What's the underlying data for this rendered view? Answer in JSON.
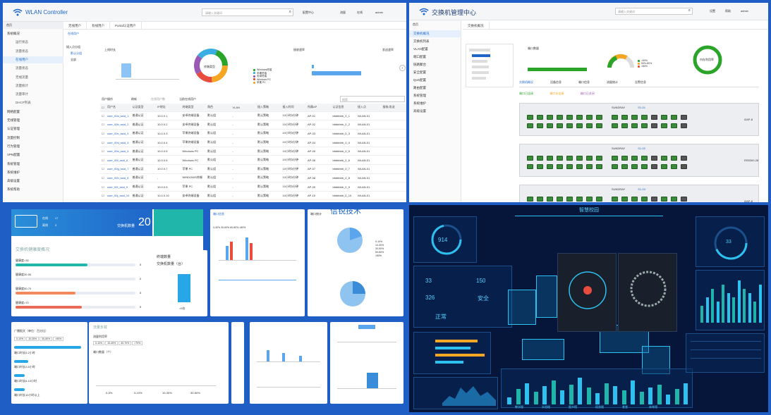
{
  "q1": {
    "app_title": "WLAN Controller",
    "search_placeholder": "请输入关键词",
    "top_links": [
      "配置中心",
      "流量",
      "在线",
      "admin"
    ],
    "left_tabs": [
      "首页",
      "导航菜单"
    ],
    "sidebar": [
      {
        "label": "系统概况",
        "active": false
      },
      {
        "label": "运行状态",
        "active": false,
        "sub": true
      },
      {
        "label": "流量状态",
        "active": false,
        "sub": true
      },
      {
        "label": "在线用户",
        "active": true,
        "sub": true
      },
      {
        "label": "流量状态",
        "active": false,
        "sub": true
      },
      {
        "label": "无线流量",
        "active": false,
        "sub": true
      },
      {
        "label": "流量统计",
        "active": false,
        "sub": true
      },
      {
        "label": "流量审计",
        "active": false,
        "sub": true
      },
      {
        "label": "DHCP列表",
        "active": false,
        "sub": true
      },
      {
        "label": "网络配置",
        "active": false
      },
      {
        "label": "无线管理",
        "active": false
      },
      {
        "label": "认证管理",
        "active": false
      },
      {
        "label": "流量控制",
        "active": false
      },
      {
        "label": "行为管理",
        "active": false
      },
      {
        "label": "VPN配置",
        "active": false
      },
      {
        "label": "系统管理",
        "active": false
      },
      {
        "label": "系统维护",
        "active": false
      },
      {
        "label": "高级设置",
        "active": false
      },
      {
        "label": "系统帮助",
        "active": false
      }
    ],
    "content_tabs": [
      "无线用户",
      "有线用户",
      "Portal认证用户"
    ],
    "page_tab": "在线用户",
    "tree": [
      "接入点分组",
      "默认分组",
      "全部"
    ],
    "chart_titles": [
      "上线时长",
      "终端类型",
      "接收速率",
      "发送速率"
    ],
    "toolbar": [
      "用户操作",
      "刷新",
      "在线用户数",
      "当前在线用户"
    ],
    "search2_placeholder": "搜索",
    "table_headers": [
      "用户名",
      "认证类型",
      "IP地址",
      "终端类型",
      "角色",
      "VLAN",
      "接入策略",
      "接入时间",
      "所属AP",
      "认证信息",
      "接入点",
      "接收/发送"
    ],
    "rows": [
      [
        "user_00a_ssid_1",
        "普通认证",
        "10.0.0.1",
        "安卓终端设备",
        "默认组",
        "-",
        "默认策略",
        "10小时3分钟",
        "AP-01",
        "bbbbbbb_0_1",
        "WLAN-01",
        ""
      ],
      [
        "user_00b_ssid_2",
        "普通认证",
        "10.0.0.2",
        "安卓终端设备",
        "默认组",
        "-",
        "默认策略",
        "10小时3分钟",
        "AP-02",
        "bbbbbbb_0_2",
        "WLAN-01",
        ""
      ],
      [
        "user_00c_ssid_3",
        "普通认证",
        "10.0.0.3",
        "苹果终端设备",
        "默认组",
        "-",
        "默认策略",
        "10小时3分钟",
        "AP-03",
        "bbbbbbb_0_3",
        "WLAN-01",
        ""
      ],
      [
        "user_00d_ssid_4",
        "普通认证",
        "10.0.0.4",
        "苹果终端设备",
        "默认组",
        "-",
        "默认策略",
        "10小时3分钟",
        "AP-04",
        "bbbbbbb_0_4",
        "WLAN-01",
        ""
      ],
      [
        "user_00e_ssid_5",
        "普通认证",
        "10.0.0.5",
        "Windows PC",
        "默认组",
        "-",
        "默认策略",
        "10小时3分钟",
        "AP-05",
        "bbbbbbb_0_5",
        "WLAN-01",
        ""
      ],
      [
        "user_00f_ssid_6",
        "普通认证",
        "10.0.0.6",
        "Windows PC",
        "默认组",
        "-",
        "默认策略",
        "10小时3分钟",
        "AP-06",
        "bbbbbbb_0_6",
        "WLAN-01",
        ""
      ],
      [
        "user_00g_ssid_7",
        "普通认证",
        "10.0.0.7",
        "苹果 PC",
        "默认组",
        "-",
        "默认策略",
        "10小时3分钟",
        "AP-07",
        "bbbbbbb_0_7",
        "WLAN-01",
        ""
      ],
      [
        "user_00h_ssid_8",
        "普通认证",
        "-",
        "WINDOWS终端",
        "默认组",
        "-",
        "默认策略",
        "10小时3分钟",
        "AP-08",
        "bbbbbbb_0_8",
        "WLAN-01",
        ""
      ],
      [
        "user_00i_ssid_9",
        "普通认证",
        "10.0.0.9",
        "苹果 PC",
        "默认组",
        "-",
        "默认策略",
        "10小时3分钟",
        "AP-09",
        "bbbbbbb_0_9",
        "WLAN-01",
        ""
      ],
      [
        "user_00j_ssid_10",
        "普通认证",
        "10.0.0.10",
        "安卓终端设备",
        "默认组",
        "-",
        "默认策略",
        "10小时3分钟",
        "AP-10",
        "bbbbbbb_0_10",
        "WLAN-01",
        ""
      ],
      [
        "user_00k_ssid_11",
        "普通认证",
        "10.0.0.11",
        "WINDOWS终端",
        "默认组",
        "-",
        "默认策略",
        "10小时3分钟",
        "AP-11",
        "bbbbbbb_0_11",
        "WLAN-01",
        ""
      ]
    ],
    "donut_center": "终端类型",
    "legend": [
      "Windows终端",
      "苹果终端",
      "安卓终端",
      "Windows PC",
      "苹果 PC"
    ]
  },
  "q2": {
    "app_title": "交换机管理中心",
    "search_placeholder": "请输入关键词",
    "top_links": [
      "设置",
      "帮助",
      "admin"
    ],
    "left_tabs": [
      "首页",
      "交换机"
    ],
    "sidebar": [
      "交换机概况",
      "交换机列表",
      "VLAN配置",
      "端口配置",
      "链路聚合",
      "安全配置",
      "QoS配置",
      "路由配置",
      "系统管理",
      "系统维护",
      "高级设置"
    ],
    "content_tab": "交换机概况",
    "ops": [
      "交换机数量",
      "端口状态"
    ],
    "kpis": [
      "端口数量",
      "CPU利用率",
      "内存利用率"
    ],
    "gauge_legend": [
      "<50%",
      "50%-80%",
      ">80%"
    ],
    "row_tabs": [
      "交换机概况",
      "设备信息",
      "端口信息",
      "流量统计",
      "告警信息"
    ],
    "status_legend": [
      "端口已连接",
      "端口未连接",
      "端口已关闭"
    ],
    "switches": [
      {
        "brand": "SUNDRAY",
        "model": "S1-01",
        "label": "i2AP-8"
      },
      {
        "brand": "SUNDRAY",
        "model": "S1-02",
        "label": "RS5300-28"
      },
      {
        "brand": "SUNDRAY",
        "model": "S1-03",
        "label": "i2AP-8"
      }
    ]
  },
  "q3": {
    "online_label": "在线",
    "online_val": "17",
    "offline_label": "离线",
    "offline_val": "3",
    "switch_count_label": "交换机数量",
    "switch_count": "20",
    "health_title": "交换机健康度概况",
    "health_rows": [
      {
        "label": "健康度<30",
        "value": "5"
      },
      {
        "label": "健康度30-50",
        "value": "0"
      },
      {
        "label": "健康度50-70",
        "value": "5"
      },
      {
        "label": "健康度>70",
        "value": "5"
      }
    ],
    "card2_title": "终端数量",
    "card2_sub": "交换机数量（台）",
    "card2_bar_label": "<5台",
    "card3_title": "端口信息",
    "card3_legend": [
      "0-30%",
      "30-60%",
      "60-80%",
      ">80%"
    ],
    "card4_title": "端口统计",
    "card4_legend": [
      "0-10%",
      "10-30%",
      "30-50%",
      "50-80%",
      ">80%"
    ],
    "bottom_title": "广播报文（单位：百分比）",
    "bottom_tabs": [
      "0-10%",
      "10-30%",
      "30-50%",
      ">50%"
    ],
    "bottom_rows": [
      "端口时长0-2小时",
      "端口时长2-6小时",
      "端口时长6-10小时",
      "端口时长10小时以上"
    ],
    "mid_title": "流量负载",
    "mid_sub": "流量利用率",
    "mid_tabs": [
      "0-10%",
      "10-40%",
      "40-70%",
      ">70%"
    ],
    "mid_axis": "端口数量（个）",
    "mid_x": [
      "0-3%",
      "3-10%",
      "10-30%",
      "30-50%"
    ],
    "watermark": "信锐技术"
  },
  "q4": {
    "title": "智慧校园",
    "ring_val": "914",
    "kpi1": "33",
    "kpi2": "150",
    "kpi3": "326",
    "safe": "安全",
    "normal": "正常",
    "right_ring": "33",
    "bottom_labels": [
      "教学楼",
      "实验楼",
      "图书馆",
      "宿舍楼",
      "食堂",
      "体育馆"
    ],
    "chart_right": [
      4,
      6,
      8,
      5,
      9,
      7,
      6,
      10,
      8,
      7,
      5,
      9
    ]
  },
  "colors": {
    "brand": "#1f66c9",
    "green": "#2aa52a",
    "orange": "#f5a623",
    "teal": "#1fb5ad",
    "cyan": "#2ec1f0"
  }
}
